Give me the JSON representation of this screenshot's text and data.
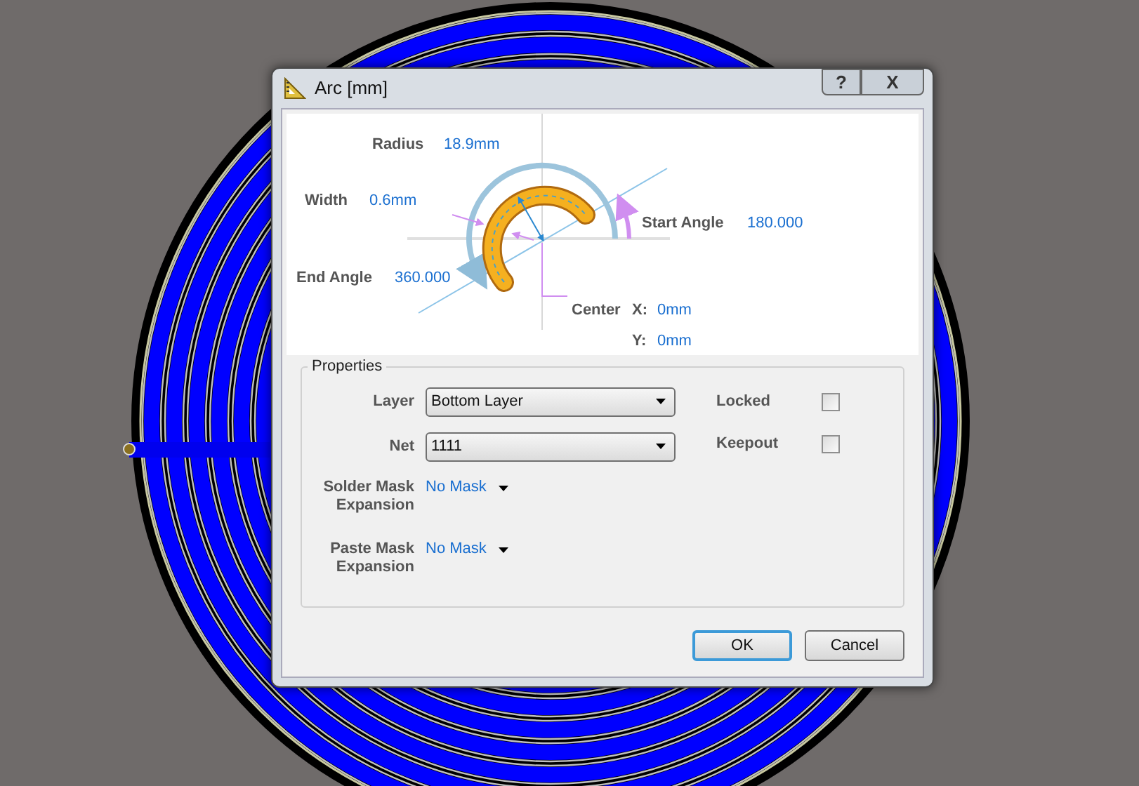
{
  "window": {
    "title": "Arc [mm]",
    "buttons": [
      {
        "kind": "help",
        "label": "?"
      },
      {
        "kind": "close",
        "label": "X"
      }
    ]
  },
  "diagram": {
    "radius": {
      "label": "Radius",
      "value": "18.9mm"
    },
    "width": {
      "label": "Width",
      "value": "0.6mm"
    },
    "start_angle": {
      "label": "Start Angle",
      "value": "180.000"
    },
    "end_angle": {
      "label": "End Angle",
      "value": "360.000"
    },
    "center": {
      "label": "Center",
      "x_label": "X:",
      "x": "0mm",
      "y_label": "Y:",
      "y": "0mm"
    }
  },
  "properties": {
    "title": "Properties",
    "fields": [
      {
        "kind": "dropdown",
        "label": "Layer",
        "value": "Bottom Layer"
      },
      {
        "kind": "dropdown",
        "label": "Net",
        "value": "1111"
      },
      {
        "kind": "link",
        "label": "Solder Mask Expansion",
        "value": "No Mask"
      },
      {
        "kind": "link",
        "label": "Paste Mask Expansion",
        "value": "No Mask"
      }
    ],
    "checkboxes": [
      {
        "label": "Locked",
        "checked": false
      },
      {
        "label": "Keepout",
        "checked": false
      }
    ]
  },
  "buttons": [
    {
      "label": "OK",
      "default": true
    },
    {
      "label": "Cancel",
      "default": false
    }
  ]
}
